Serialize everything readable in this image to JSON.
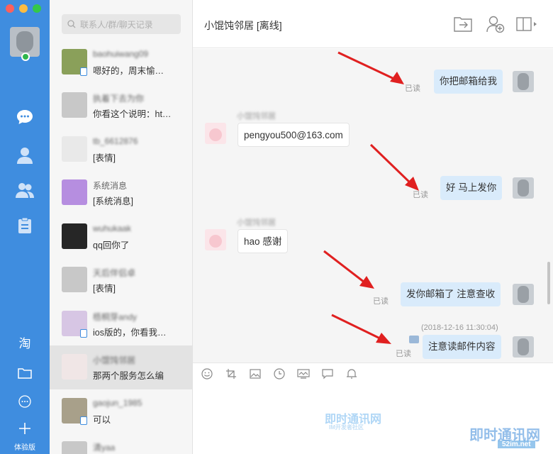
{
  "window": {
    "dot_colors": [
      "#fc605c",
      "#fdbc40",
      "#34c84a"
    ]
  },
  "rail": {
    "items": [
      {
        "name": "chat-icon",
        "active": true
      },
      {
        "name": "contact-icon"
      },
      {
        "name": "group-icon"
      },
      {
        "name": "clipboard-icon"
      }
    ],
    "bottom": [
      {
        "name": "taobao-icon",
        "text": "淘"
      },
      {
        "name": "folder-icon"
      },
      {
        "name": "more-icon"
      },
      {
        "name": "plus-icon"
      }
    ],
    "version_label": "体验版"
  },
  "search": {
    "placeholder": "联系人/群/聊天记录"
  },
  "contacts": [
    {
      "name": "baohuiwang09",
      "message": "嗯好的，周末愉…",
      "mobile": true
    },
    {
      "name": "执着下去为你",
      "message": "你看这个说明：ht…",
      "mobile": false
    },
    {
      "name": "tb_6612876",
      "message": "[表情]",
      "mobile": false
    },
    {
      "name": "系统消息",
      "message": "[系统消息]",
      "mobile": false
    },
    {
      "name": "wuhukaak",
      "message": "qq回你了",
      "mobile": false
    },
    {
      "name": "天后伴侣卓",
      "message": "[表情]",
      "mobile": false
    },
    {
      "name": "梧桐芽andy",
      "message": "ios版的，你看我…",
      "mobile": true
    },
    {
      "name": "小馄饨邻居",
      "message": "那两个服务怎么编",
      "mobile": false,
      "selected": true
    },
    {
      "name": "gaojun_1985",
      "message": "可以",
      "mobile": true
    },
    {
      "name": "清yaa",
      "message": "",
      "mobile": false
    }
  ],
  "chat": {
    "title": "小馄饨邻居 [离线]",
    "header_icons": [
      "share-icon",
      "add-contact-icon",
      "layout-icon"
    ],
    "read_label": "已读",
    "sender_name": "小馄饨邻居",
    "messages": [
      {
        "dir": "out",
        "text": "你把邮箱给我",
        "read": true
      },
      {
        "dir": "in",
        "text": "pengyou500@163.com"
      },
      {
        "dir": "out",
        "text": "好 马上发你",
        "read": true
      },
      {
        "dir": "in",
        "text": "hao 感谢"
      },
      {
        "dir": "out",
        "text": "发你邮箱了 注意查收",
        "read": true
      },
      {
        "dir": "out",
        "text": "注意读邮件内容",
        "read": true
      }
    ],
    "timestamp": "(2018-12-16 11:30:04)",
    "toolbar": [
      "emoji-icon",
      "crop-icon",
      "image-icon",
      "clock-icon",
      "screen-icon",
      "bubble-icon",
      "bell-icon"
    ]
  },
  "watermark": {
    "text1": "即时通讯网",
    "text2": "即时通讯网",
    "site": "52im.net",
    "sub": "IM开发者社区"
  }
}
